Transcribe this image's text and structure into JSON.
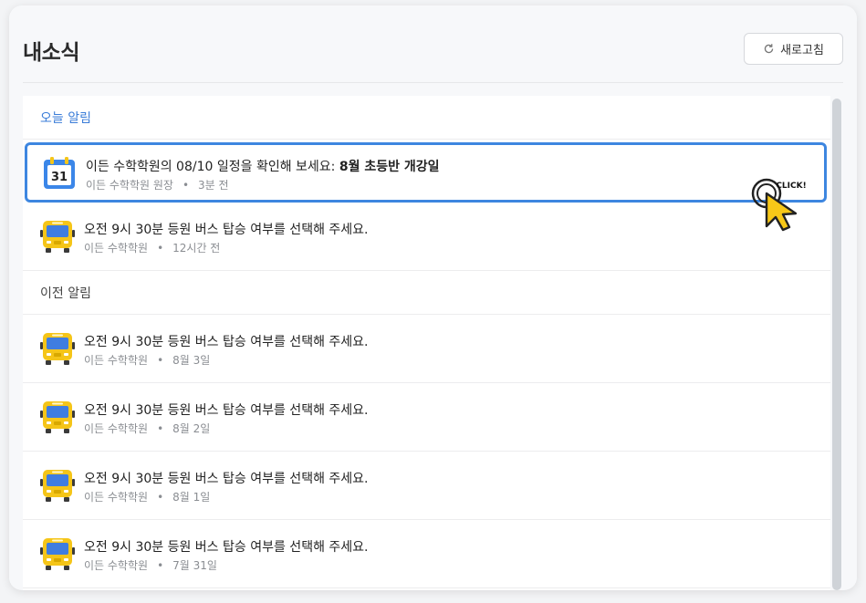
{
  "header": {
    "title": "내소식",
    "refresh_label": "새로고침"
  },
  "sections": {
    "today_label": "오늘 알림",
    "previous_label": "이전 알림"
  },
  "today_items": [
    {
      "icon": "calendar-icon",
      "calendar_day": "31",
      "text_prefix": "이든 수학학원의 08/10 일정을 확인해 보세요: ",
      "text_bold": "8월 초등반 개강일",
      "sender": "이든 수학학원 원장",
      "time": "3분 전",
      "selected": true
    },
    {
      "icon": "bus-icon",
      "text": "오전 9시 30분 등원 버스 탑승 여부를 선택해 주세요.",
      "sender": "이든 수학학원",
      "time": "12시간 전"
    }
  ],
  "previous_items": [
    {
      "icon": "bus-icon",
      "text": "오전 9시 30분 등원 버스 탑승 여부를 선택해 주세요.",
      "sender": "이든 수학학원",
      "time": "8월 3일"
    },
    {
      "icon": "bus-icon",
      "text": "오전 9시 30분 등원 버스 탑승 여부를 선택해 주세요.",
      "sender": "이든 수학학원",
      "time": "8월 2일"
    },
    {
      "icon": "bus-icon",
      "text": "오전 9시 30분 등원 버스 탑승 여부를 선택해 주세요.",
      "sender": "이든 수학학원",
      "time": "8월 1일"
    },
    {
      "icon": "bus-icon",
      "text": "오전 9시 30분 등원 버스 탑승 여부를 선택해 주세요.",
      "sender": "이든 수학학원",
      "time": "7월 31일"
    }
  ],
  "cursor_label": "CLICK!",
  "colors": {
    "accent": "#3d86e0",
    "section_today": "#3b7dd8",
    "bus_yellow": "#f5c518",
    "bus_window": "#3f7de0"
  }
}
